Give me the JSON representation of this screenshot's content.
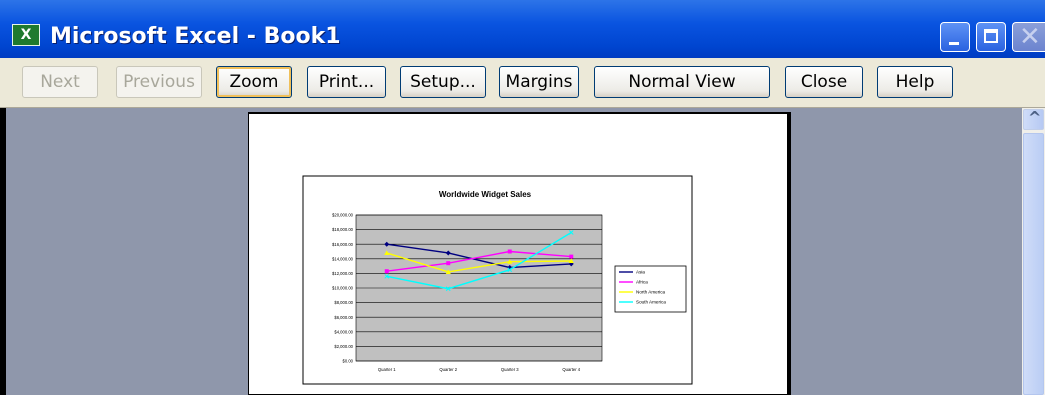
{
  "window": {
    "title": "Microsoft Excel - Book1",
    "app_icon": "excel-icon"
  },
  "toolbar": {
    "buttons": [
      {
        "label": "Next",
        "enabled": false
      },
      {
        "label": "Previous",
        "enabled": false
      },
      {
        "label": "Zoom",
        "enabled": true
      },
      {
        "label": "Print...",
        "enabled": true
      },
      {
        "label": "Setup...",
        "enabled": true
      },
      {
        "label": "Margins",
        "enabled": true
      },
      {
        "label": "Normal View",
        "enabled": true
      },
      {
        "label": "Close",
        "enabled": true
      },
      {
        "label": "Help",
        "enabled": true
      }
    ]
  },
  "chart_data": {
    "type": "line",
    "title": "Worldwide Widget Sales",
    "categories": [
      "Quarter 1",
      "Quarter 2",
      "Quarter 3",
      "Quarter 4"
    ],
    "ylim": [
      0,
      20000
    ],
    "yticks": [
      "$20,000.00",
      "$18,000.00",
      "$16,000.00",
      "$14,000.00",
      "$12,000.00",
      "$10,000.00",
      "$8,000.00",
      "$6,000.00",
      "$4,000.00",
      "$2,000.00",
      "$0.00"
    ],
    "grid": true,
    "legend_position": "right",
    "series": [
      {
        "name": "Asia",
        "color": "#000080",
        "marker": "diamond",
        "values": [
          16000,
          14800,
          12800,
          13300
        ]
      },
      {
        "name": "Africa",
        "color": "#ff00ff",
        "marker": "square",
        "values": [
          12300,
          13400,
          15000,
          14300
        ]
      },
      {
        "name": "North America",
        "color": "#ffff00",
        "marker": "triangle",
        "values": [
          14800,
          12200,
          13600,
          13700
        ]
      },
      {
        "name": "South America",
        "color": "#00ffff",
        "marker": "x",
        "values": [
          11600,
          9900,
          12500,
          17600
        ]
      }
    ]
  },
  "colors": {
    "titlebar": "#0a54e0",
    "plot_area": "#c0c0c0",
    "workspace": "#8f97ab"
  }
}
